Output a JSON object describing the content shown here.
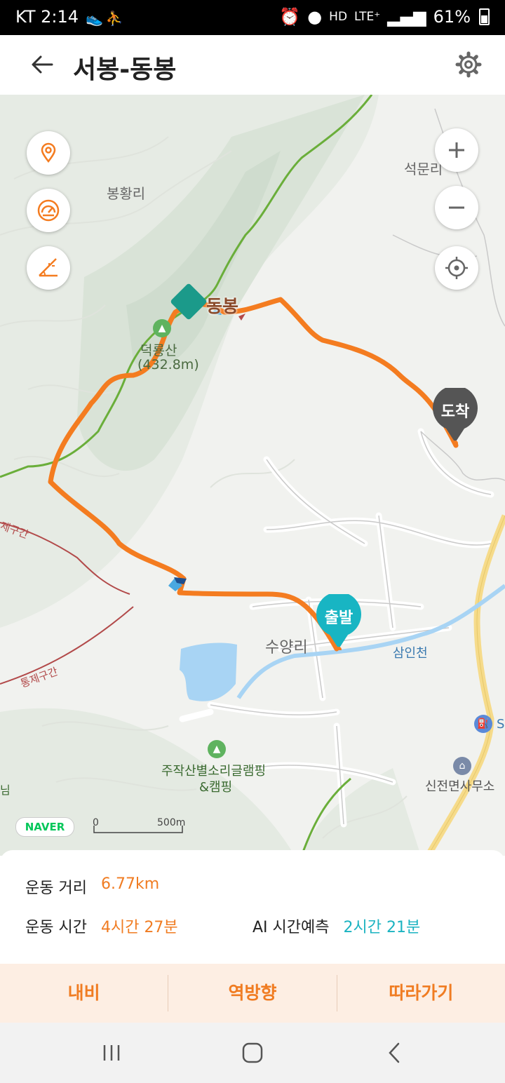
{
  "status_bar": {
    "carrier_time": "KT 2:14",
    "network": "LTE⁺",
    "hd": "HD",
    "battery": "61%"
  },
  "header": {
    "title": "서봉-동봉"
  },
  "map": {
    "labels": {
      "village_top": "봉황리",
      "village_right": "석문리",
      "mountain": "덕룡산",
      "mountain_height": "(432.8m)",
      "peak": "동봉",
      "village_center": "수양리",
      "stream": "삼인천",
      "camping": "주작산별소리글램핑",
      "camping2": "&캠핑",
      "office": "신전면사무소",
      "restricted1": "통제구간",
      "restricted2": "제구간",
      "edge_s": "S",
      "edge_left": "님"
    },
    "pins": {
      "start": "출발",
      "end": "도착"
    },
    "naver": "NAVER",
    "scale_zero": "0",
    "scale_label": "500m",
    "colors": {
      "route": "#f47c20",
      "ridge": "#6aae3a",
      "water": "#a8d4f4",
      "road": "#f6db8a"
    }
  },
  "stats": {
    "distance_label": "운동 거리",
    "distance_value": "6.77km",
    "time_label": "운동 시간",
    "time_value": "4시간 27분",
    "ai_label": "AI 시간예측",
    "ai_value": "2시간 21분"
  },
  "actions": {
    "nav": "내비",
    "reverse": "역방향",
    "follow": "따라가기"
  }
}
